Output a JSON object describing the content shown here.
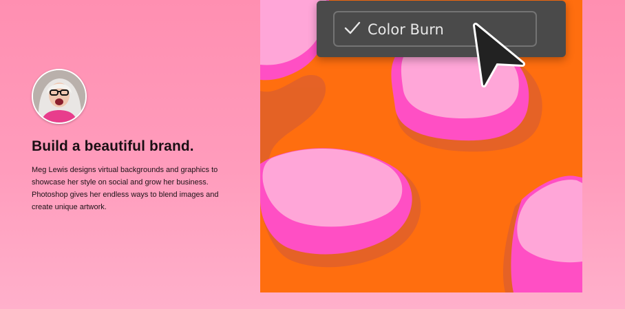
{
  "promo": {
    "headline": "Build a beautiful brand.",
    "description": "Meg Lewis designs virtual backgrounds and graphics to showcase her style on social and grow her business. Photoshop gives her endless ways to blend images and create unique artwork."
  },
  "blend_menu": {
    "selected_option": "Color Burn",
    "check_icon": "check-icon"
  },
  "cursor": {
    "icon": "pointer-cursor-icon"
  },
  "colors": {
    "background_pink": "#ff8fb1",
    "artwork_orange": "#ff6e0f",
    "artwork_pink": "#ff4fc4",
    "artwork_light_pink": "#ffa6d8",
    "menu_gray": "#4a4a4a"
  }
}
